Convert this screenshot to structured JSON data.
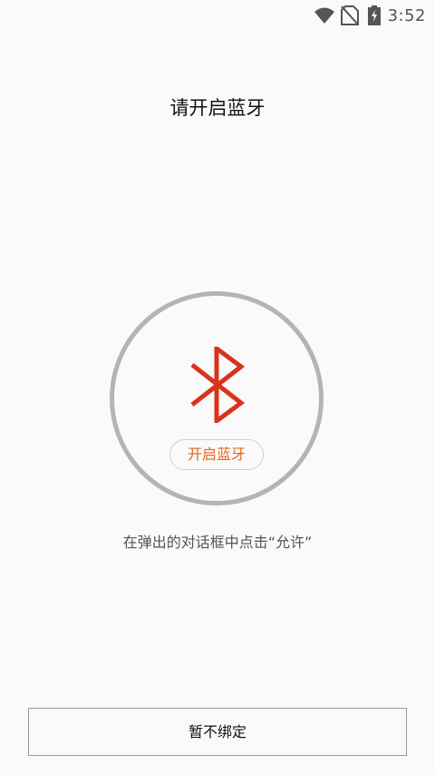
{
  "status_bar": {
    "time": "3:52",
    "icons": [
      "wifi-icon",
      "no-sim-icon",
      "battery-charging-icon"
    ]
  },
  "page": {
    "title": "请开启蓝牙",
    "enable_button_label": "开启蓝牙",
    "hint": "在弹出的对话框中点击“允许”",
    "skip_button_label": "暂不绑定"
  },
  "colors": {
    "accent": "#e8631c",
    "bluetooth_icon": "#d8341b",
    "ring": "#b4b4b4",
    "background": "#fafafa"
  }
}
